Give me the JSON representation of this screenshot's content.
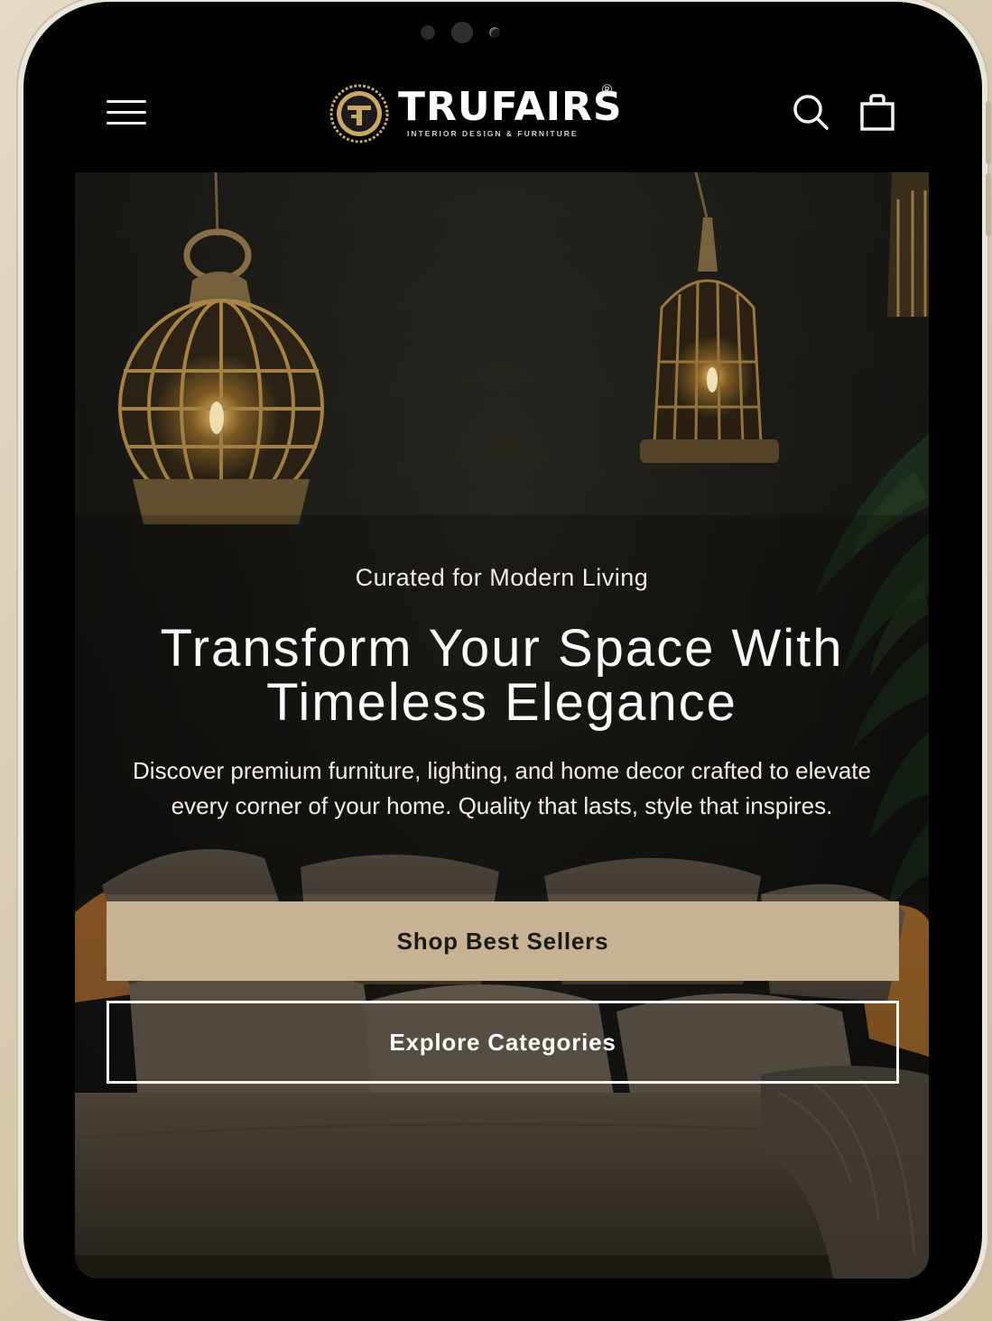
{
  "device": {
    "type": "tablet-frame"
  },
  "header": {
    "menu_icon": "hamburger-menu-icon",
    "brand": {
      "name": "TRUFAIRS",
      "registered_mark": "®",
      "tagline": "INTERIOR DESIGN & FURNITURE",
      "emblem_icon": "trufairs-emblem-logo"
    },
    "search_icon": "search-icon",
    "cart_icon": "shopping-bag-icon"
  },
  "hero": {
    "eyebrow": "Curated for Modern Living",
    "headline_line1": "Transform Your Space With",
    "headline_line2": "Timeless Elegance",
    "description": "Discover premium furniture, lighting, and home decor crafted to elevate every corner of your home. Quality that lasts, style that inspires.",
    "primary_button": "Shop Best Sellers",
    "secondary_button": "Explore Categories"
  },
  "colors": {
    "primary_button_bg": "#c7b393",
    "header_bg": "#000000",
    "accent_gold": "#c9a861",
    "page_bg": "#d9cdb5"
  }
}
